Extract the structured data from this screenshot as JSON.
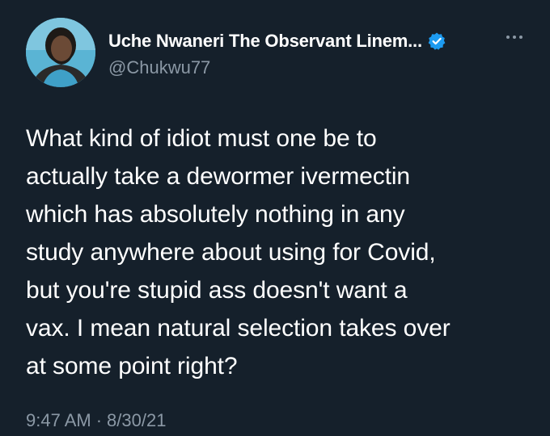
{
  "tweet": {
    "author": {
      "display_name": "Uche Nwaneri The Observant Linem...",
      "handle": "@Chukwu77",
      "verified": true
    },
    "text": "What kind of idiot must one be to\nactually take a dewormer ivermectin\nwhich has absolutely nothing in any\nstudy anywhere about using for Covid,\nbut you're stupid ass doesn't want a\nvax. I mean natural selection takes over\nat some point right?",
    "time": "9:47 AM",
    "separator": "·",
    "date": "8/30/21"
  },
  "colors": {
    "background": "#15202b",
    "text": "#ffffff",
    "secondary_text": "#8b98a5",
    "verified_badge": "#1d9bf0"
  },
  "icons": {
    "verified": "verified-badge-icon",
    "more": "more-options-icon"
  }
}
